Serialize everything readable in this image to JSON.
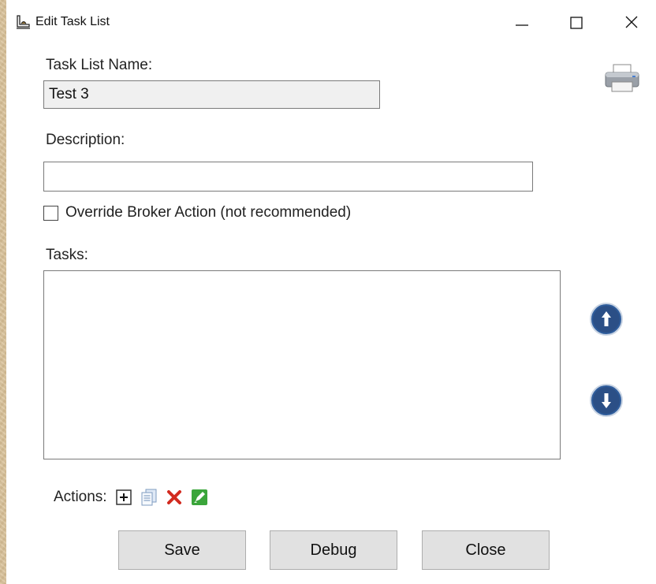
{
  "window": {
    "title": "Edit Task List",
    "controls": [
      "minimize-icon",
      "maximize-icon",
      "close-icon"
    ]
  },
  "form": {
    "name_label": "Task List Name:",
    "name_value": "Test 3",
    "description_label": "Description:",
    "description_value": "",
    "override_label": "Override Broker Action (not recommended)",
    "override_checked": false,
    "tasks_label": "Tasks:",
    "tasks_items": []
  },
  "actions": {
    "label": "Actions:",
    "icons": [
      "add-icon",
      "copy-icon",
      "delete-icon",
      "edit-icon"
    ]
  },
  "side_buttons": [
    "move-up-icon",
    "move-down-icon",
    "printer-icon"
  ],
  "buttons": {
    "save": "Save",
    "debug": "Debug",
    "close": "Close"
  },
  "colors": {
    "accent_blue": "#2f5d9c",
    "delete_red": "#d22a1f",
    "edit_green": "#3aa53a",
    "button_face": "#e1e1e1"
  }
}
